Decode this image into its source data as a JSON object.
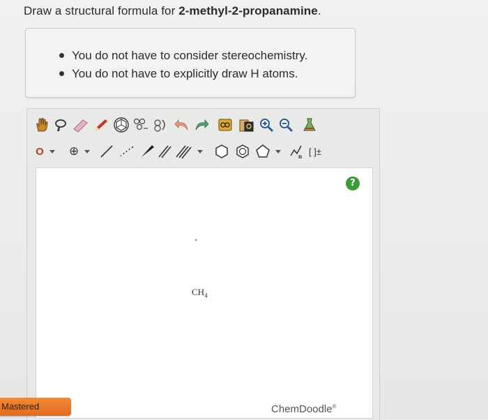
{
  "question": {
    "prefix": "Draw a structural formula for ",
    "compound": "2-methyl-2-propanamine",
    "suffix": "."
  },
  "hints": [
    "You do not have to consider stereochemistry.",
    "You do not have to explicitly draw H atoms."
  ],
  "toolbar": {
    "row1": [
      "hand-icon",
      "lasso-icon",
      "eraser-icon",
      "ring-center-icon",
      "clean-icon",
      "undo-icon",
      "redo-icon",
      "copy-icon",
      "paste-icon",
      "zoom-in-icon",
      "zoom-out-icon",
      "flask-icon"
    ],
    "row2": {
      "atom_label": "O",
      "charge_label": "⊕",
      "brackets_label": "[ ]±"
    }
  },
  "canvas": {
    "help_label": "?",
    "ch4_main": "CH",
    "ch4_sub": "4"
  },
  "footer": {
    "brand": "ChemDoodle",
    "brand_mark": "®",
    "status": "Mastered"
  },
  "colors": {
    "help": "#3f9b3a",
    "status": "#e26a1b",
    "accent_pencil": "#c0392b"
  }
}
